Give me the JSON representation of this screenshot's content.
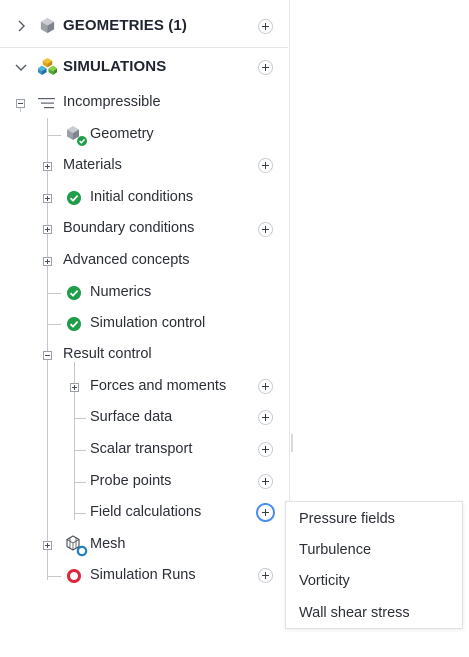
{
  "sections": {
    "geometries": {
      "title": "GEOMETRIES (1)",
      "icon": "cube-gray-icon"
    },
    "simulations": {
      "title": "SIMULATIONS",
      "icon": "cube-colored-icon"
    }
  },
  "tree": {
    "root": {
      "label": "Incompressible"
    },
    "items": {
      "geometry": {
        "label": "Geometry"
      },
      "materials": {
        "label": "Materials"
      },
      "initial_conditions": {
        "label": "Initial conditions"
      },
      "boundary_conditions": {
        "label": "Boundary conditions"
      },
      "advanced_concepts": {
        "label": "Advanced concepts"
      },
      "numerics": {
        "label": "Numerics"
      },
      "simulation_control": {
        "label": "Simulation control"
      },
      "result_control": {
        "label": "Result control"
      },
      "forces_and_moments": {
        "label": "Forces and moments"
      },
      "surface_data": {
        "label": "Surface data"
      },
      "scalar_transport": {
        "label": "Scalar transport"
      },
      "probe_points": {
        "label": "Probe points"
      },
      "field_calculations": {
        "label": "Field calculations"
      },
      "mesh": {
        "label": "Mesh"
      },
      "simulation_runs": {
        "label": "Simulation Runs"
      }
    }
  },
  "dropdown": {
    "items": [
      "Pressure fields",
      "Turbulence",
      "Vorticity",
      "Wall shear stress"
    ]
  },
  "colors": {
    "accent": "#4a8cf0",
    "ok": "#1f9d4a",
    "error": "#e0263a"
  }
}
